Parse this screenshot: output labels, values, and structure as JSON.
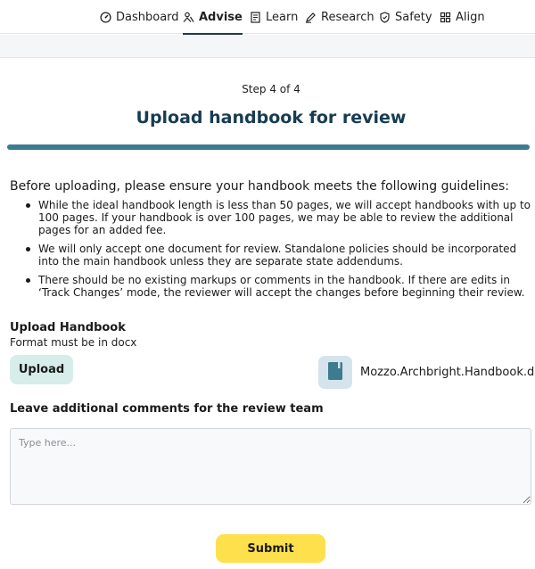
{
  "nav": {
    "items": [
      {
        "label": "Dashboard",
        "icon": "dashboard-gauge-icon",
        "active": false
      },
      {
        "label": "Advise",
        "icon": "advise-people-icon",
        "active": true
      },
      {
        "label": "Learn",
        "icon": "learn-book-icon",
        "active": false
      },
      {
        "label": "Research",
        "icon": "research-pen-icon",
        "active": false
      },
      {
        "label": "Safety",
        "icon": "safety-shield-icon",
        "active": false
      },
      {
        "label": "Align",
        "icon": "align-grid-icon",
        "active": false
      }
    ]
  },
  "page": {
    "step": "Step 4 of 4",
    "title": "Upload handbook for review",
    "intro": "Before uploading, please ensure your handbook meets the following guidelines:",
    "guidelines": [
      "While the ideal handbook length is less than 50 pages, we will accept handbooks with up to 100 pages. If your handbook is over 100 pages, we may be able to review the additional pages for an added fee.",
      "We will only accept one document for review. Standalone policies should be incorporated into the main handbook unless they are separate state addendums.",
      "There should be no existing markups or comments in the handbook. If there are edits in ‘Track Changes’ mode, the reviewer will accept the changes before beginning their review."
    ],
    "progress_fraction": 1.0
  },
  "upload": {
    "label": "Upload Handbook",
    "hint": "Format must be in docx",
    "button_label": "Upload",
    "file_name": "Mozzo.Archbright.Handbook.docx",
    "file_icon": "document-icon"
  },
  "comments": {
    "label": "Leave additional comments for the review team",
    "placeholder": "Type here...",
    "value": ""
  },
  "submit_label": "Submit",
  "colors": {
    "title": "#173c52",
    "progress": "#3d7b91",
    "upload_button": "#d6ede9",
    "file_icon_bg": "#d5e3ec",
    "file_icon": "#3d7b91",
    "submit_button": "#fedf4c"
  }
}
